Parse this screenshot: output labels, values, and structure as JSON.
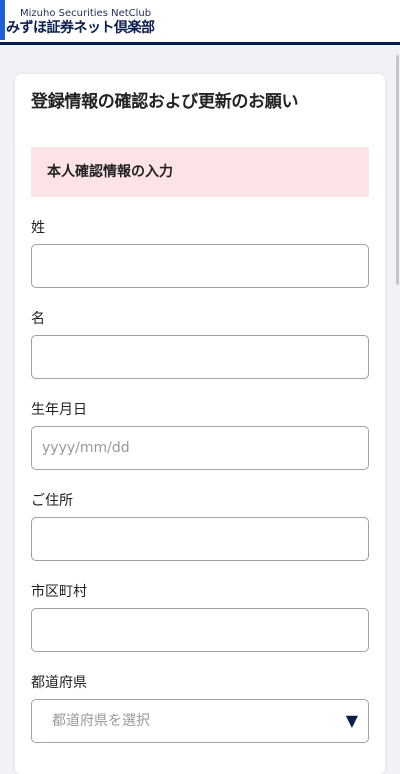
{
  "header": {
    "logo_sub": "Mizuho Securities NetClub",
    "logo_main": "みずほ証券ネット倶楽部"
  },
  "card": {
    "title": "登録情報の確認および更新のお願い",
    "section_title": "本人確認情報の入力"
  },
  "fields": {
    "last_name": {
      "label": "姓",
      "value": ""
    },
    "first_name": {
      "label": "名",
      "value": ""
    },
    "birthdate": {
      "label": "生年月日",
      "value": "",
      "placeholder": "yyyy/mm/dd"
    },
    "address": {
      "label": "ご住所",
      "value": ""
    },
    "city": {
      "label": "市区町村",
      "value": ""
    },
    "prefecture": {
      "label": "都道府県",
      "selected": "都道府県を選択",
      "arrow": "▼"
    }
  },
  "colors": {
    "header_navy": "#0b1f4f",
    "header_accent": "#1e5fd1",
    "banner_pink": "#fde3e6",
    "page_bg": "#f1f2f5"
  },
  "icons": {
    "select_arrow": "triangle-down-icon"
  }
}
